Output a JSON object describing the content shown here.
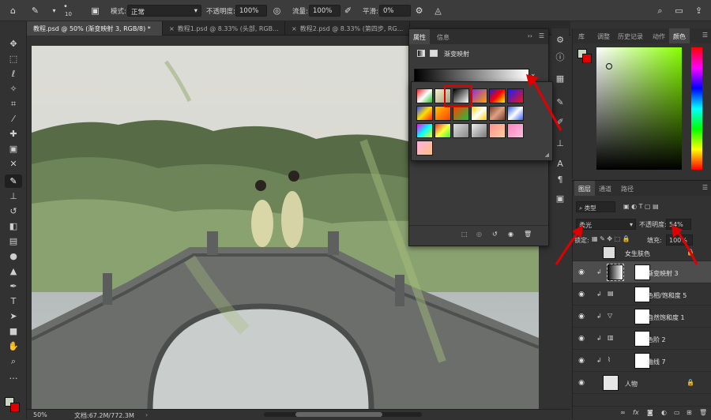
{
  "options_bar": {
    "brush_size": "10",
    "mode_label": "模式:",
    "mode_value": "正常",
    "opacity_label": "不透明度:",
    "opacity_value": "100%",
    "flow_label": "流量:",
    "flow_value": "100%",
    "smoothing_label": "平滑:",
    "smoothing_value": "0%"
  },
  "doc_tabs": [
    {
      "label": "教程.psd @ 50% (渐变映射 3, RGB/8) *",
      "active": true
    },
    {
      "label": "教程1.psd @ 8.33% (头部, RGB...",
      "active": false
    },
    {
      "label": "教程2.psd @ 8.33% (第四步, RG...",
      "active": false
    }
  ],
  "status": {
    "zoom": "50%",
    "doc_info": "文档:67.2M/772.3M"
  },
  "properties": {
    "tabs": [
      "属性",
      "信息"
    ],
    "header": "渐变映射",
    "swatches": [
      "linear-gradient(135deg,#ff2020,#ffffff 50%,#20c020)",
      "linear-gradient(135deg,#f4f0c8,#a0a080)",
      "linear-gradient(135deg,#000,#fff)",
      "linear-gradient(135deg,#8a2be2,#ffa500)",
      "linear-gradient(135deg,#2020d0,#ff0000,#ffff00)",
      "linear-gradient(135deg,#1020ff,#ff1010)",
      "linear-gradient(135deg,#3050ff,#ffdd00,#ff2020)",
      "linear-gradient(135deg,#ffc000,#ff4000)",
      "linear-gradient(135deg,#ff4000,#20c040)",
      "linear-gradient(135deg,#ffd000,#fff,#ffd000)",
      "linear-gradient(135deg,#704030,#e0a080,#704030)",
      "linear-gradient(135deg,#3060ff,#fff,#3060ff)",
      "linear-gradient(135deg,#ff00ff,#00ffff,#ffff00)",
      "linear-gradient(135deg,#ff3030,#ffff40,#30ff30)",
      "linear-gradient(135deg,#dcdcdc,#888)",
      "linear-gradient(135deg,#eee,#777)",
      "linear-gradient(135deg,#ff9090,#ffd0a0)",
      "linear-gradient(135deg,#ff80c0,#ffc0e0)",
      "linear-gradient(135deg,#ffb0e0,#ffc080)"
    ]
  },
  "right_tabs": [
    "库",
    "调整",
    "历史记录",
    "动作",
    "颜色"
  ],
  "layers": {
    "tabs": [
      "图层",
      "通道",
      "路径"
    ],
    "filter_label": "类型",
    "blend_mode": "柔光",
    "opacity_label": "不透明度:",
    "opacity_value": "54%",
    "lock_label": "锁定:",
    "fill_label": "填充:",
    "fill_value": "100%",
    "rows": [
      {
        "name": "女生肤色"
      },
      {
        "name": "渐变映射 3"
      },
      {
        "name": "色相/饱和度 5"
      },
      {
        "name": "自然饱和度 1"
      },
      {
        "name": "色阶 2"
      },
      {
        "name": "曲线 7"
      },
      {
        "name": "人物"
      }
    ]
  },
  "colors": {
    "accent": "#e00000",
    "panel": "#323232",
    "selected_row": "#4d4d4d"
  }
}
